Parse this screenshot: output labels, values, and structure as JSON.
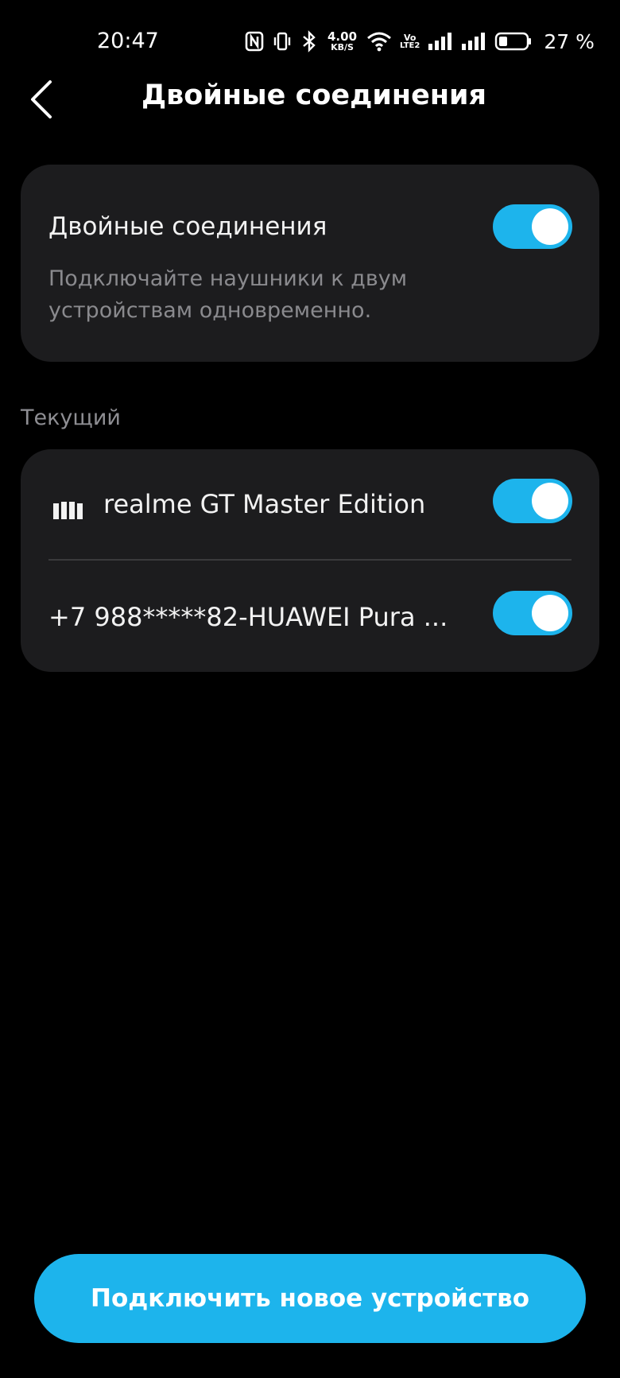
{
  "status_bar": {
    "time": "20:47",
    "net_speed_value": "4.00",
    "net_speed_unit": "KB/S",
    "volte_top": "Vo",
    "volte_bottom": "LTE2",
    "battery_percent": "27 %",
    "icons": [
      "nfc-icon",
      "vibrate-icon",
      "bluetooth-icon",
      "wifi-icon",
      "signal-icon",
      "signal-icon",
      "battery-icon"
    ]
  },
  "header": {
    "title": "Двойные соединения",
    "back_icon": "chevron-left-icon"
  },
  "dual_card": {
    "title": "Двойные соединения",
    "description": "Подключайте наушники к двум устройствам одновременно.",
    "enabled": true
  },
  "current_section": {
    "label": "Текущий"
  },
  "devices": [
    {
      "name": "realme GT Master Edition",
      "icon": "signal-bars-icon",
      "enabled": true
    },
    {
      "name": "+7 988*****82-HUAWEI Pura ...",
      "enabled": true
    }
  ],
  "footer": {
    "connect_label": "Подключить новое устройство"
  },
  "colors": {
    "accent": "#1db4ec",
    "background": "#000000",
    "card": "#1c1c1e",
    "secondary_text": "#8a8a8e"
  }
}
